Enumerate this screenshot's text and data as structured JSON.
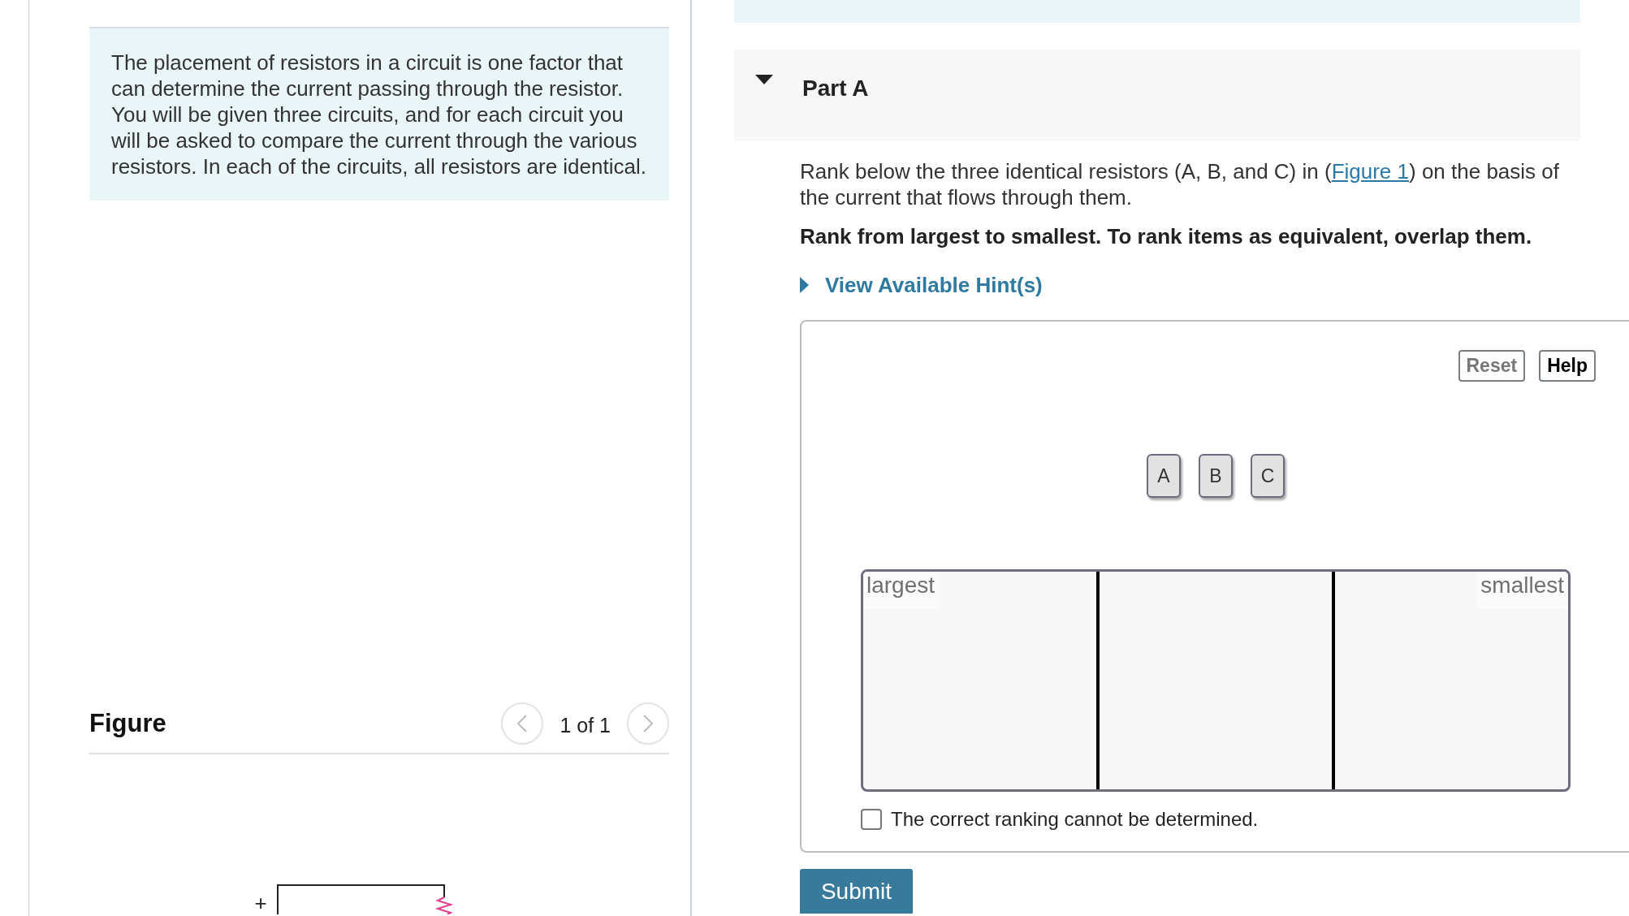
{
  "intro": "The placement of resistors in a circuit is one factor that can determine the current passing through the resistor. You will be given three circuits, and for each circuit you will be asked to compare the current through the various resistors. In each of the circuits, all resistors are identical.",
  "figure": {
    "title": "Figure",
    "pager": "1 of 1",
    "previous": {
      "disabled": true
    },
    "next": {
      "disabled": true
    },
    "circuit_labels": [
      "+"
    ]
  },
  "part": {
    "title": "Part A",
    "expanded": true
  },
  "question": {
    "before": "Rank below the three identical resistors (A, B, and C) in (",
    "link": "Figure 1",
    "after": ") on the basis of the current that flows through them."
  },
  "instruction": "Rank from largest to smallest. To rank items as equivalent, overlap them.",
  "hints": {
    "label": "View Available Hint(s)",
    "expanded": false
  },
  "ranking": {
    "buttons": [
      {
        "label": "Reset",
        "disabled": true
      },
      {
        "label": "Help",
        "disabled": false
      }
    ],
    "items": [
      "A",
      "B",
      "C"
    ],
    "largest_label": "largest",
    "smallest_label": "smallest"
  },
  "cannot_determine": {
    "label": "The correct ranking cannot be determined.",
    "checked": false
  },
  "submit": {
    "label": "Submit"
  }
}
